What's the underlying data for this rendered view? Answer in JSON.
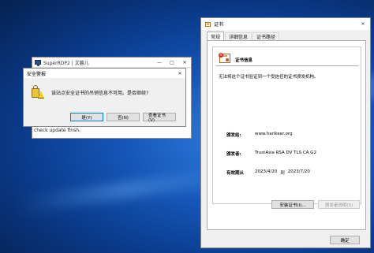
{
  "superrdp": {
    "title": "SuperRDP2 | 文暮儿",
    "log_line": "check update finsh."
  },
  "security_warning": {
    "title": "安全警报",
    "message": "该站点安全证书的吊销信息不可用。是否继续?",
    "buttons": {
      "yes": "是(Y)",
      "no": "否(N)",
      "view_cert": "查看证书(V)"
    }
  },
  "certificate": {
    "title": "证书",
    "tabs": [
      "常规",
      "详细信息",
      "证书路径"
    ],
    "info_title": "证书信息",
    "warning": "无法将这个证书验证到一个受信任的证书颁发机构。",
    "issued_to_label": "颁发给:",
    "issued_to_value": "www.harikeer.org",
    "issued_by_label": "颁发者:",
    "issued_by_value": "TrustAsia RSA DV TLS CA G2",
    "validity_label": "有效期从",
    "valid_from": "2023/4/20",
    "to_word": "到",
    "valid_to": "2023/7/20",
    "install_button": "安装证书(I)...",
    "issuer_statement_button": "颁发者说明(S)",
    "ok_button": "确定"
  }
}
